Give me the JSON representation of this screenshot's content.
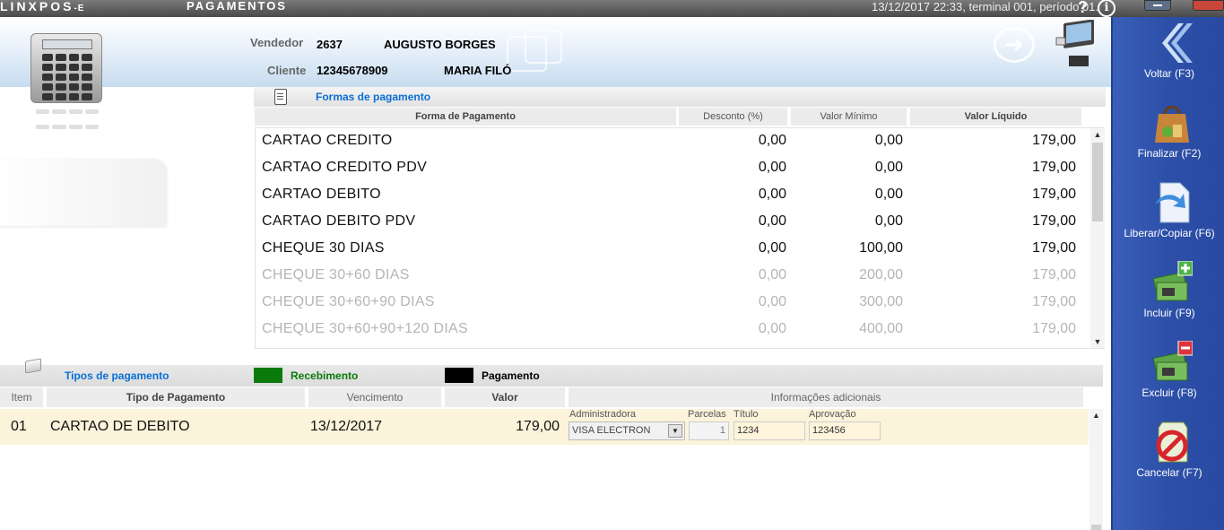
{
  "titlebar": {
    "brand_main": "LINXPOS",
    "brand_sub": "-E",
    "screen_title": "PAGAMENTOS",
    "status": "13/12/2017 22:33, terminal 001, período 01.",
    "help": "?",
    "info": "i"
  },
  "header": {
    "vendedor_label": "Vendedor",
    "vendedor_code": "2637",
    "vendedor_name": "AUGUSTO BORGES",
    "cliente_label": "Cliente",
    "cliente_code": "12345678909",
    "cliente_name": "MARIA FILÓ"
  },
  "formas": {
    "title": "Formas de pagamento",
    "columns": [
      "Forma de Pagamento",
      "Desconto (%)",
      "Valor Mínimo",
      "Valor Líquido"
    ],
    "rows": [
      {
        "name": "CARTAO CREDITO",
        "desconto": "0,00",
        "minimo": "0,00",
        "liquido": "179,00",
        "enabled": true
      },
      {
        "name": "CARTAO CREDITO PDV",
        "desconto": "0,00",
        "minimo": "0,00",
        "liquido": "179,00",
        "enabled": true
      },
      {
        "name": "CARTAO DEBITO",
        "desconto": "0,00",
        "minimo": "0,00",
        "liquido": "179,00",
        "enabled": true
      },
      {
        "name": "CARTAO DEBITO PDV",
        "desconto": "0,00",
        "minimo": "0,00",
        "liquido": "179,00",
        "enabled": true
      },
      {
        "name": "CHEQUE 30 DIAS",
        "desconto": "0,00",
        "minimo": "100,00",
        "liquido": "179,00",
        "enabled": true
      },
      {
        "name": "CHEQUE 30+60 DIAS",
        "desconto": "0,00",
        "minimo": "200,00",
        "liquido": "179,00",
        "enabled": false
      },
      {
        "name": "CHEQUE 30+60+90 DIAS",
        "desconto": "0,00",
        "minimo": "300,00",
        "liquido": "179,00",
        "enabled": false
      },
      {
        "name": "CHEQUE 30+60+90+120 DIAS",
        "desconto": "0,00",
        "minimo": "400,00",
        "liquido": "179,00",
        "enabled": false
      }
    ]
  },
  "tipos": {
    "title": "Tipos de pagamento",
    "legend_recebimento": "Recebimento",
    "legend_pagamento": "Pagamento",
    "legend_recebimento_color": "#0a7a0a",
    "legend_pagamento_color": "#000000",
    "columns": [
      "Item",
      "Tipo de Pagamento",
      "Vencimento",
      "Valor",
      "Informações adicionais"
    ],
    "row": {
      "item": "01",
      "tipo": "CARTAO DE DEBITO",
      "vencimento": "13/12/2017",
      "valor": "179,00",
      "administradora_label": "Administradora",
      "administradora": "VISA ELECTRON",
      "parcelas_label": "Parcelas",
      "parcelas": "1",
      "titulo_label": "Título",
      "titulo": "1234",
      "aprovacao_label": "Aprovação",
      "aprovacao": "123456"
    }
  },
  "sidebar": {
    "buttons": [
      {
        "label": "Voltar (F3)",
        "icon": "back-chevron-icon"
      },
      {
        "label": "Finalizar (F2)",
        "icon": "shopping-bag-icon"
      },
      {
        "label": "Liberar/Copiar (F6)",
        "icon": "document-copy-icon"
      },
      {
        "label": "Incluir (F9)",
        "icon": "money-add-icon"
      },
      {
        "label": "Excluir (F8)",
        "icon": "money-remove-icon"
      },
      {
        "label": "Cancelar (F7)",
        "icon": "cancel-icon"
      }
    ]
  }
}
